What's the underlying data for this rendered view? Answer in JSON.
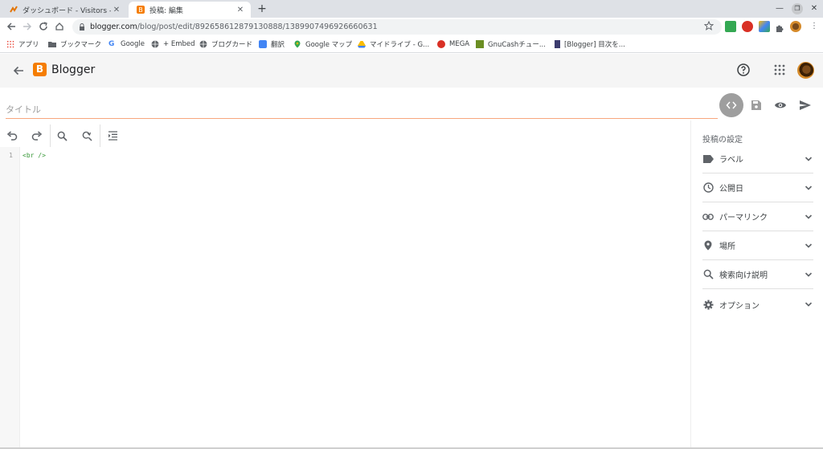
{
  "browser": {
    "tabs": [
      {
        "title": "ダッシュボード - Visitors - Vis",
        "active": false,
        "favicon": "analytics-icon"
      },
      {
        "title": "投稿: 編集",
        "active": true,
        "favicon": "blogger-icon"
      }
    ],
    "url": {
      "host": "blogger.com",
      "path": "/blog/post/edit/8926586128791308​88/1389907496926660631"
    },
    "bookmarks": [
      {
        "label": "アプリ",
        "icon": "apps-grid-icon"
      },
      {
        "label": "ブックマーク",
        "icon": "folder-icon"
      },
      {
        "label": "Google",
        "icon": "google-icon"
      },
      {
        "label": "+ Embed",
        "icon": "globe-icon"
      },
      {
        "label": "ブログカード",
        "icon": "globe-icon"
      },
      {
        "label": "翻訳",
        "icon": "translate-icon"
      },
      {
        "label": "Google マップ",
        "icon": "maps-pin-icon"
      },
      {
        "label": "マイドライブ - G...",
        "icon": "drive-icon"
      },
      {
        "label": "MEGA",
        "icon": "mega-icon"
      },
      {
        "label": "GnuCashチュー...",
        "icon": "gnucash-icon"
      },
      {
        "label": "[Blogger] 目次を...",
        "icon": "blogger-bookmark-icon"
      }
    ]
  },
  "app": {
    "brand": "Blogger",
    "brand_color": "#f57d00"
  },
  "editor": {
    "title_placeholder": "タイトル",
    "line_number": "1",
    "code": "<br />"
  },
  "sidebar": {
    "heading": "投稿の設定",
    "items": [
      {
        "label": "ラベル",
        "icon": "label-icon"
      },
      {
        "label": "公開日",
        "icon": "clock-icon"
      },
      {
        "label": "パーマリンク",
        "icon": "link-icon"
      },
      {
        "label": "場所",
        "icon": "location-pin-icon"
      },
      {
        "label": "検索向け説明",
        "icon": "search-icon"
      },
      {
        "label": "オプション",
        "icon": "gear-icon"
      }
    ]
  }
}
